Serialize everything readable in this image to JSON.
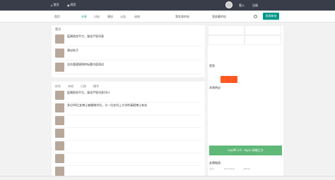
{
  "topbar": {
    "home": "首页",
    "site": "网页",
    "login": "登入",
    "register": "注册"
  },
  "subnav": {
    "tabs": [
      "首页",
      "",
      "分享",
      "讨论",
      "建议",
      "公告",
      "动态",
      "",
      "",
      "我发表的帖",
      "我收藏的帖"
    ],
    "post_label": "发表新帖"
  },
  "pinned": {
    "title": "置顶",
    "rows": [
      {
        "title": "疫情防控不力，湖北严惩问责",
        "meta": "",
        "badge": "",
        "count": ""
      },
      {
        "title": "建议帖子",
        "meta": "",
        "badge": "",
        "count": ""
      },
      {
        "title": "总台管理规律的标题内容测试",
        "meta": "",
        "badge": "",
        "count": ""
      }
    ]
  },
  "feed": {
    "tabs": [
      "综合",
      "未结",
      "已结",
      "精华"
    ],
    "rows": [
      {
        "title": "疫情防控不力，湖北严惩问责19人",
        "meta": "",
        "badge": "",
        "count": ""
      },
      {
        "title": "多位90后女博士被撤销学位，与一位名叫上大学的真假博士有关",
        "meta": "",
        "badge": "",
        "count": ""
      },
      {
        "title": "",
        "meta": "",
        "badge": "",
        "count": ""
      },
      {
        "title": "",
        "meta": "",
        "badge": "",
        "count": ""
      },
      {
        "title": "",
        "meta": "",
        "badge": "",
        "count": ""
      },
      {
        "title": "",
        "meta": "",
        "badge": "",
        "count": ""
      },
      {
        "title": "",
        "meta": "",
        "badge": "",
        "count": ""
      }
    ]
  },
  "sidebar": {
    "sign_in": "签到",
    "layui": "LayIM 3.0 - layui 前端之力",
    "reply_list_title": "本周热议",
    "links_title": "友情链接",
    "links": [
      "layui",
      "Gaochhub",
      "github",
      ""
    ]
  },
  "status": {
    "text": ""
  }
}
